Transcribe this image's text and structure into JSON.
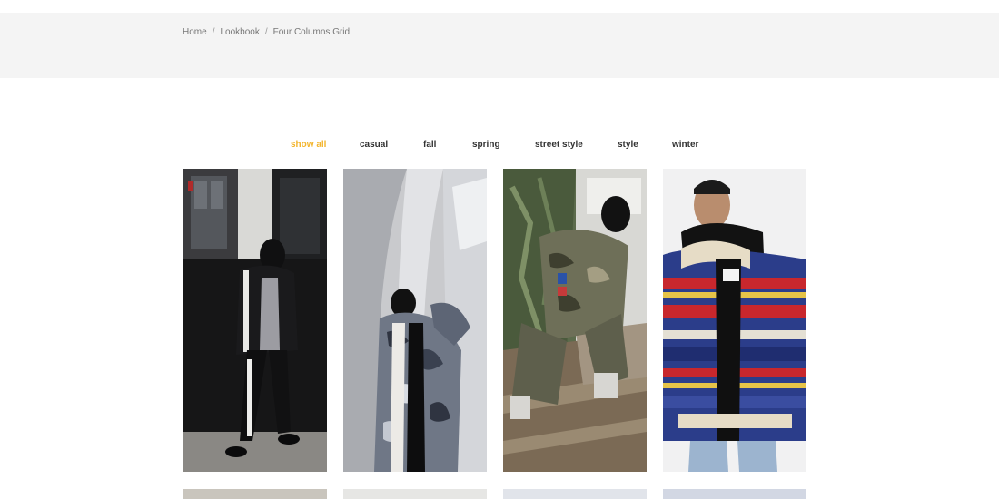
{
  "breadcrumb": {
    "home": "Home",
    "section": "Lookbook",
    "current": "Four Columns Grid",
    "separator": "/"
  },
  "filters": [
    {
      "label": "show all",
      "active": true
    },
    {
      "label": "casual",
      "active": false
    },
    {
      "label": "fall",
      "active": false
    },
    {
      "label": "spring",
      "active": false
    },
    {
      "label": "street style",
      "active": false
    },
    {
      "label": "style",
      "active": false
    },
    {
      "label": "winter",
      "active": false
    }
  ],
  "colors": {
    "accent": "#f3b52d",
    "band": "#f4f4f4",
    "text": "#333333",
    "muted": "#777777"
  },
  "gallery": {
    "items": [
      {
        "alt": "model in black track jacket and balaclava"
      },
      {
        "alt": "model in camo puffer jacket against white architecture"
      },
      {
        "alt": "model in camo jacket crouching on bench"
      },
      {
        "alt": "model in striped wool jacket"
      }
    ]
  }
}
